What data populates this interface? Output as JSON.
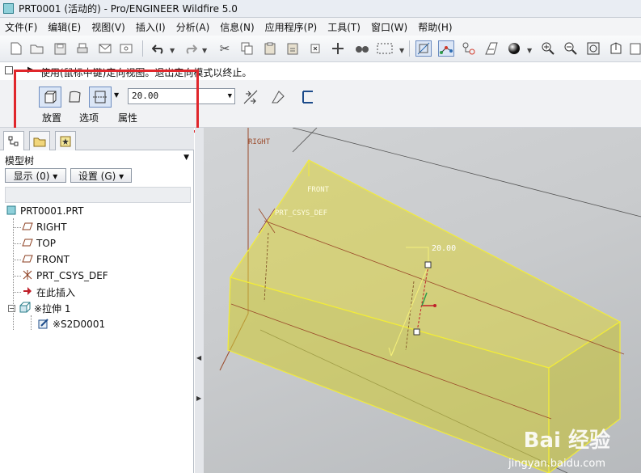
{
  "window": {
    "title": "PRT0001 (活动的) - Pro/ENGINEER Wildfire 5.0"
  },
  "menubar": {
    "items": [
      "文件(F)",
      "编辑(E)",
      "视图(V)",
      "插入(I)",
      "分析(A)",
      "信息(N)",
      "应用程序(P)",
      "工具(T)",
      "窗口(W)",
      "帮助(H)"
    ]
  },
  "message": {
    "text": "使用(鼠标中键)定向视图。退出定向模式以终止。"
  },
  "dashboard": {
    "depth_value": "20.00",
    "tabs": [
      "放置",
      "选项",
      "属性"
    ],
    "highlight_color": "#e0262b"
  },
  "sidepanel": {
    "header": "模型树",
    "show_button": "显示 (0) ▾",
    "settings_button": "设置 (G) ▾",
    "tree": [
      {
        "label": "PRT0001.PRT",
        "icon": "part-icon"
      },
      {
        "label": "RIGHT",
        "icon": "datum-plane-icon"
      },
      {
        "label": "TOP",
        "icon": "datum-plane-icon"
      },
      {
        "label": "FRONT",
        "icon": "datum-plane-icon"
      },
      {
        "label": "PRT_CSYS_DEF",
        "icon": "csys-icon"
      },
      {
        "label": "在此插入",
        "icon": "insert-arrow-icon"
      },
      {
        "label": "※拉伸 1",
        "icon": "extrude-icon"
      },
      {
        "label": "※S2D0001",
        "icon": "sketch-icon"
      }
    ]
  },
  "viewport": {
    "labels": {
      "right": "RIGHT",
      "front": "FRONT",
      "csys": "PRT_CSYS_DEF",
      "dimension": "20.00"
    },
    "colors": {
      "solid": "#d9d236",
      "edge": "#f2ec3a",
      "datum": "#9a4a2a",
      "background": "#c9cbcd"
    },
    "watermark": "Bai 经验",
    "watermark_url": "jingyan.baidu.com"
  }
}
